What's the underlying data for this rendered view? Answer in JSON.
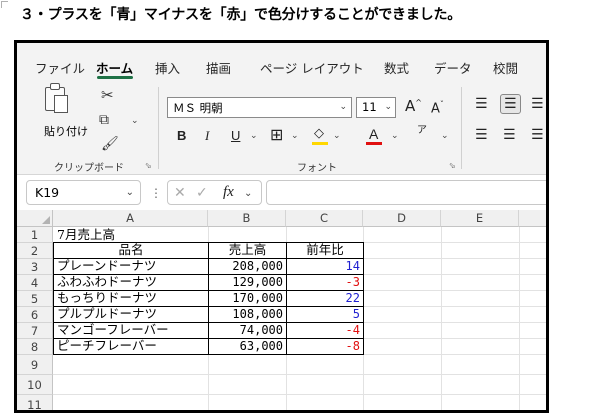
{
  "heading": "３・プラスを「青」マイナスを「赤」で色分けすることができました。",
  "ribbon": {
    "tabs": [
      "ファイル",
      "ホーム",
      "挿入",
      "描画",
      "ページ レイアウト",
      "数式",
      "データ",
      "校閲"
    ],
    "active_tab": "ホーム",
    "paste_label": "貼り付け",
    "clipboard_label": "クリップボード",
    "font_name": "ＭＳ 明朝",
    "font_size": "11",
    "font_group_label": "フォント",
    "bold": "B",
    "italic": "I",
    "underline": "U",
    "grow": "A",
    "shrink": "A",
    "font_color_glyph": "A",
    "phonetic_glyph": "ア"
  },
  "formula_bar": {
    "name_box": "K19",
    "fx_label": "fx",
    "formula": ""
  },
  "sheet": {
    "columns": [
      "A",
      "B",
      "C",
      "D",
      "E"
    ],
    "rows": [
      "1",
      "2",
      "3",
      "4",
      "5",
      "6",
      "7",
      "8",
      "9",
      "10",
      "11"
    ],
    "title": "7月売上高",
    "headers": [
      "品名",
      "売上高",
      "前年比"
    ],
    "records": [
      {
        "name": "プレーンドーナツ",
        "sales": "208,000",
        "yoy": "14",
        "color": "#1f1fd0"
      },
      {
        "name": "ふわふわドーナツ",
        "sales": "129,000",
        "yoy": "-3",
        "color": "#e01010"
      },
      {
        "name": "もっちりドーナツ",
        "sales": "170,000",
        "yoy": "22",
        "color": "#1f1fd0"
      },
      {
        "name": "プルプルドーナツ",
        "sales": "108,000",
        "yoy": "5",
        "color": "#1f1fd0"
      },
      {
        "name": "マンゴーフレーバー",
        "sales": "74,000",
        "yoy": "-4",
        "color": "#e01010"
      },
      {
        "name": "ピーチフレーバー",
        "sales": "63,000",
        "yoy": "-8",
        "color": "#e01010"
      }
    ]
  },
  "colors": {
    "accent": "#1e7145",
    "positive": "#1f1fd0",
    "negative": "#e01010",
    "highlight": "#ffd700",
    "font_red": "#e01010"
  }
}
